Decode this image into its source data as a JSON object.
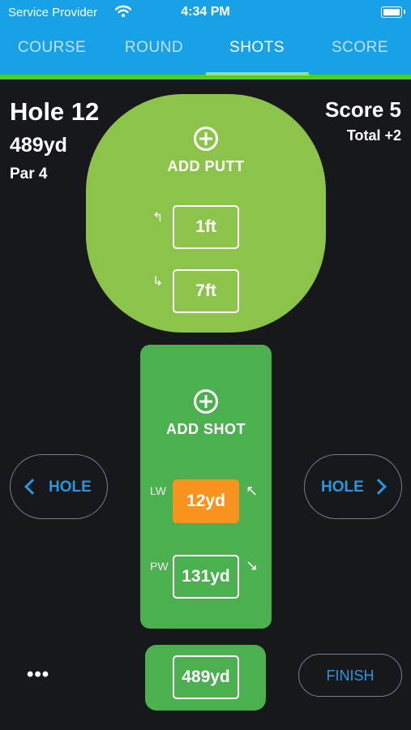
{
  "status_bar": {
    "carrier": "Service Provider",
    "time": "4:34 PM"
  },
  "tabs": [
    {
      "label": "COURSE",
      "active": false
    },
    {
      "label": "ROUND",
      "active": false
    },
    {
      "label": "SHOTS",
      "active": true
    },
    {
      "label": "SCORE",
      "active": false
    }
  ],
  "hole": {
    "title": "Hole 12",
    "yardage": "489yd",
    "par": "Par 4"
  },
  "score": {
    "label": "Score 5",
    "total": "Total +2"
  },
  "putts": {
    "add_label": "ADD PUTT",
    "items": [
      {
        "arrow": "↰",
        "value": "1ft"
      },
      {
        "arrow": "↳",
        "value": "7ft"
      }
    ]
  },
  "shots": {
    "add_label": "ADD SHOT",
    "items": [
      {
        "club": "LW",
        "value": "12yd",
        "arrow": "↖",
        "highlight": true,
        "color": "#f7931e"
      },
      {
        "club": "PW",
        "value": "131yd",
        "arrow": "↘",
        "highlight": false
      }
    ]
  },
  "nav": {
    "prev_label": "HOLE",
    "next_label": "HOLE"
  },
  "bottom": {
    "more_label": "•••",
    "distance": "489yd",
    "finish_label": "FINISH"
  },
  "colors": {
    "header": "#18a1e6",
    "accent_bar": "#4fd01f",
    "putt_green": "#8cc34a",
    "shot_green": "#4caf50",
    "link_blue": "#2a96dd",
    "highlight_orange": "#f7931e"
  }
}
